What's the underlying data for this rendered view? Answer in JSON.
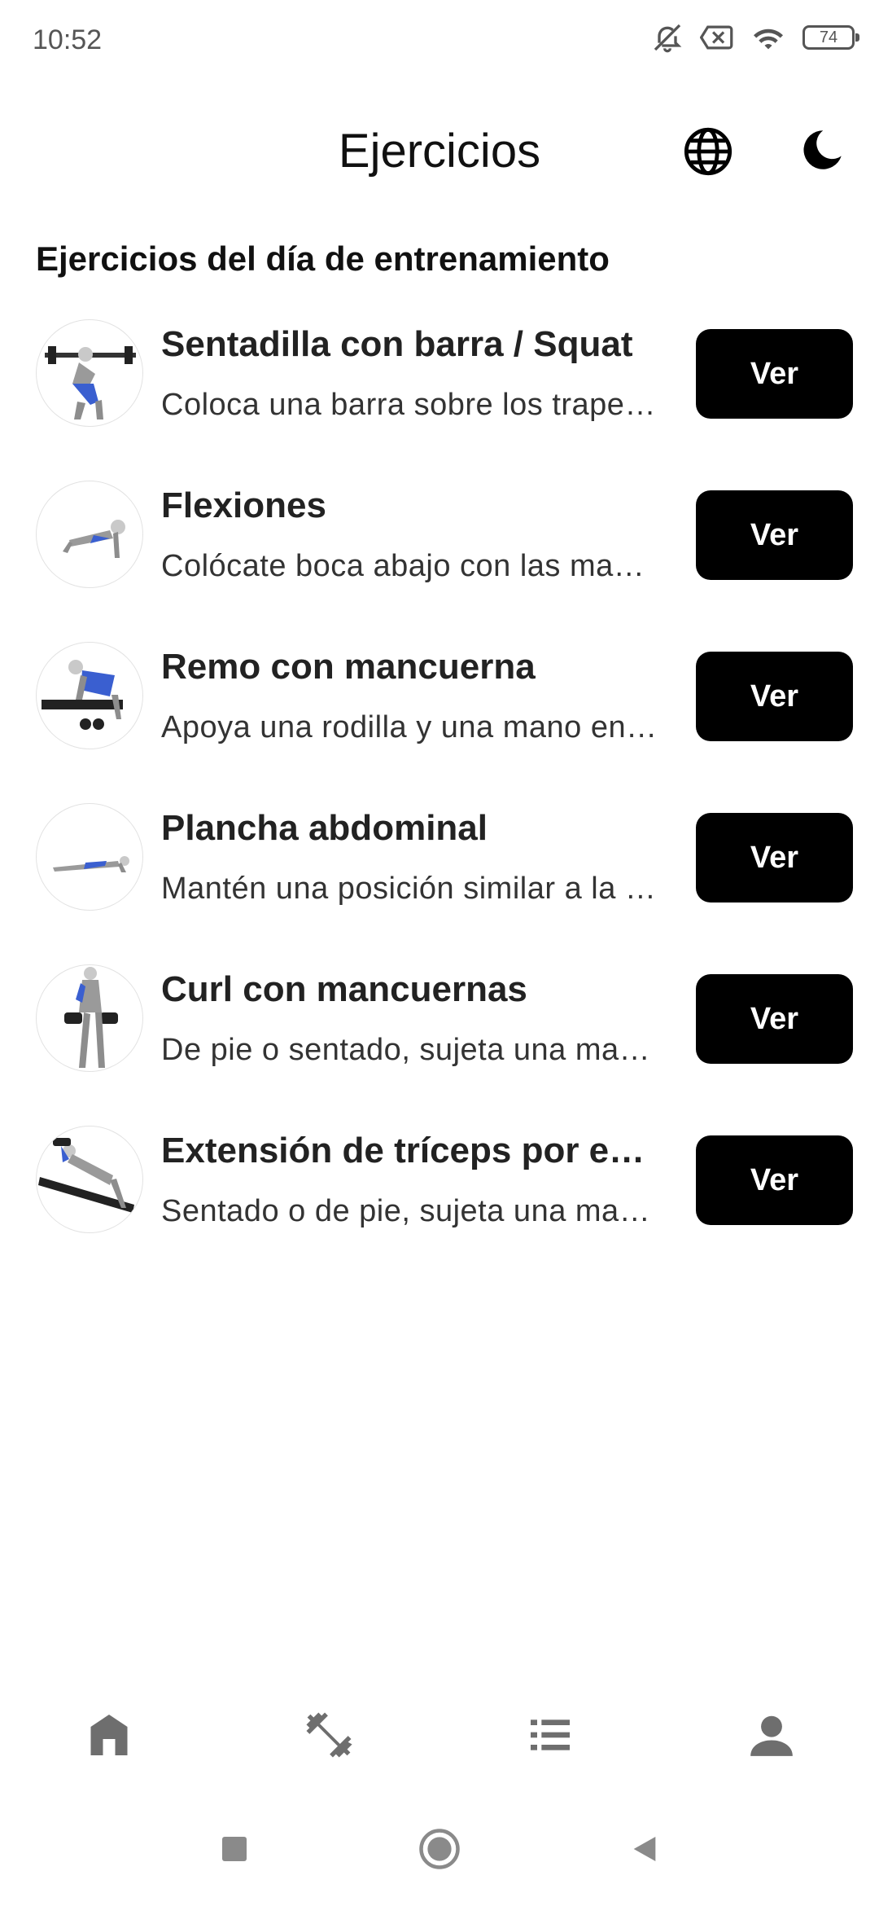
{
  "status_bar": {
    "time": "10:52",
    "battery_level": "74",
    "icons": [
      "mute-bell-icon",
      "sim-off-icon",
      "wifi-icon",
      "battery-icon"
    ]
  },
  "header": {
    "title": "Ejercicios",
    "language_icon": "globe-icon",
    "theme_icon": "moon-icon"
  },
  "section": {
    "title": "Ejercicios del día de entrenamiento"
  },
  "exercises": [
    {
      "name": "Sentadilla con barra / Squat",
      "description": "Coloca una barra sobre los trapecios y realiza una sentadilla",
      "button": "Ver"
    },
    {
      "name": "Flexiones",
      "description": "Colócate boca abajo con las manos apoyadas en el suelo",
      "button": "Ver"
    },
    {
      "name": "Remo con mancuerna",
      "description": "Apoya una rodilla y una mano en el banco",
      "button": "Ver"
    },
    {
      "name": "Plancha abdominal",
      "description": "Mantén una posición similar a la de una flexión",
      "button": "Ver"
    },
    {
      "name": "Curl con mancuernas",
      "description": "De pie o sentado, sujeta una mancuerna en cada mano",
      "button": "Ver"
    },
    {
      "name": "Extensión de tríceps por encima de la cabeza",
      "description": "Sentado o de pie, sujeta una mancuerna con ambas manos",
      "button": "Ver"
    }
  ],
  "bottom_nav": {
    "items": [
      "home-icon",
      "dumbbell-icon",
      "list-icon",
      "person-icon"
    ]
  },
  "colors": {
    "button_bg": "#000000",
    "button_text": "#ffffff",
    "nav_icon": "#6e6e6e"
  }
}
